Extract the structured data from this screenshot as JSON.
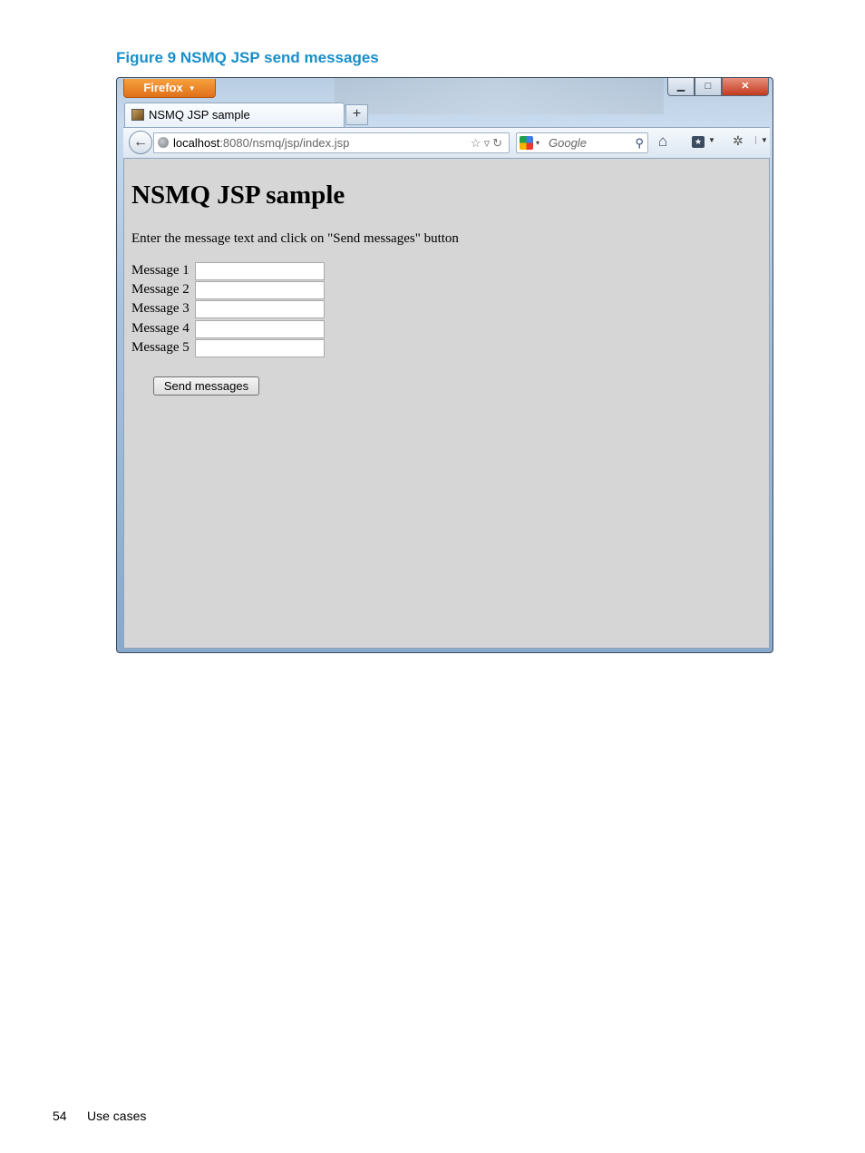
{
  "figure": {
    "title": "Figure 9 NSMQ JSP send messages"
  },
  "browser": {
    "menu_button": "Firefox",
    "window_controls": {
      "minimize": "▁",
      "maximize": "□",
      "close": "✕"
    },
    "tab": {
      "title": "NSMQ JSP sample",
      "new_tab": "+"
    },
    "url": {
      "host": "localhost",
      "rest": ":8080/nsmq/jsp/index.jsp"
    },
    "search": {
      "placeholder": "Google"
    },
    "icons": [
      "back-arrow-icon",
      "globe-icon",
      "star-icon",
      "reload-icon",
      "google-icon",
      "search-icon",
      "home-icon",
      "bookmarks-icon",
      "addon-icon"
    ]
  },
  "page": {
    "heading": "NSMQ JSP sample",
    "instruction": "Enter the message text and click on \"Send messages\" button",
    "fields": [
      {
        "label": "Message 1",
        "value": ""
      },
      {
        "label": "Message 2",
        "value": ""
      },
      {
        "label": "Message 3",
        "value": ""
      },
      {
        "label": "Message 4",
        "value": ""
      },
      {
        "label": "Message 5",
        "value": ""
      }
    ],
    "submit_label": "Send messages"
  },
  "footer": {
    "page_number": "54",
    "section": "Use cases"
  },
  "colors": {
    "figure_title": "#1a8fc9",
    "content_bg": "#d6d6d6",
    "firefox_orange": "#e0701a"
  }
}
